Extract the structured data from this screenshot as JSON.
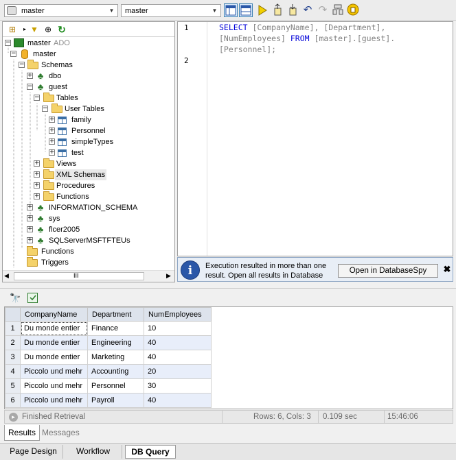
{
  "toolbar": {
    "datasource": "master",
    "database": "master",
    "icons": [
      "layout-toggle-icon",
      "layout-toggle2-icon",
      "execute-icon",
      "import-icon",
      "export-icon",
      "undo-icon",
      "redo-icon",
      "options-icon",
      "sql-format-icon"
    ]
  },
  "tree": {
    "root": {
      "label": "master",
      "suffix": "ADO"
    },
    "database": "master",
    "schemas": "Schemas",
    "dbo": "dbo",
    "guest": "guest",
    "tables": "Tables",
    "user_tables": "User Tables",
    "table_items": [
      "family",
      "Personnel",
      "simpleTypes",
      "test"
    ],
    "guest_folders": [
      "Views",
      "XML Schemas",
      "Procedures",
      "Functions"
    ],
    "other_schemas": [
      "INFORMATION_SCHEMA",
      "sys",
      "flcer2005",
      "SQLServerMSFTFTEUs"
    ],
    "db_folders": [
      "Functions",
      "Triggers"
    ],
    "scroll_thumb": "III"
  },
  "editor": {
    "line_numbers": [
      "1",
      "2"
    ],
    "sql": {
      "select": "SELECT",
      "col1": "[CompanyName],",
      "col2": "[Department],",
      "col3": "[NumEmployees]",
      "from": "FROM",
      "table": "[master].[guest].",
      "table2": "[Personnel];"
    }
  },
  "info_bar": {
    "message": "Execution resulted in more than one result. Open all results in Database",
    "button": "Open in DatabaseSpy",
    "close": "✖"
  },
  "results": {
    "columns": [
      "CompanyName",
      "Department",
      "NumEmployees"
    ],
    "rows": [
      [
        "1",
        "Du monde entier",
        "Finance",
        "10"
      ],
      [
        "2",
        "Du monde entier",
        "Engineering",
        "40"
      ],
      [
        "3",
        "Du monde entier",
        "Marketing",
        "40"
      ],
      [
        "4",
        "Piccolo und mehr",
        "Accounting",
        "20"
      ],
      [
        "5",
        "Piccolo und mehr",
        "Personnel",
        "30"
      ],
      [
        "6",
        "Piccolo und mehr",
        "Payroll",
        "40"
      ]
    ],
    "status": {
      "message": "Finished Retrieval",
      "rows_cols": "Rows: 6, Cols: 3",
      "duration": "0.109 sec",
      "time": "15:46:06"
    },
    "tabs": [
      "Results",
      "Messages"
    ]
  },
  "view_tabs": [
    "Page Design",
    "Workflow",
    "DB Query"
  ],
  "colors": {
    "keyword": "#0000d8",
    "identifier": "#808080",
    "header_bg": "#dde3ec",
    "alt_row": "#e8eefa"
  }
}
